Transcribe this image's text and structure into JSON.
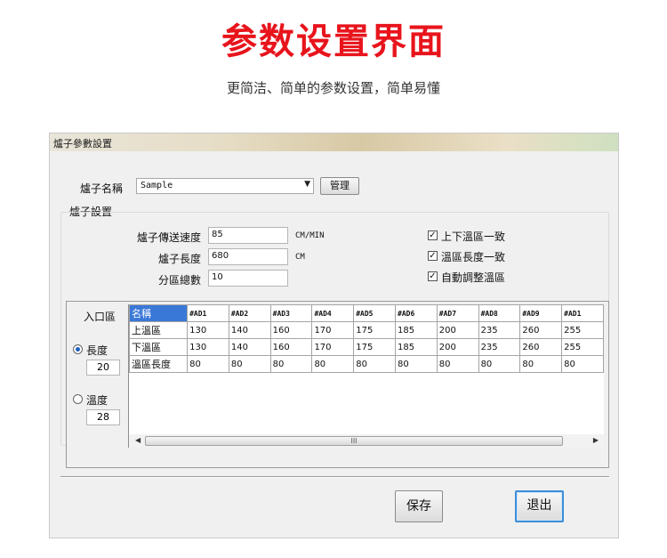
{
  "promo": {
    "title": "参数设置界面",
    "subtitle": "更简洁、简单的参数设置，简单易懂"
  },
  "window": {
    "title": "爐子參數設置"
  },
  "furnace_name": {
    "label": "爐子名稱",
    "value": "Sample",
    "manage_button": "管理"
  },
  "furnace_settings": {
    "group_label": "爐子設置",
    "speed": {
      "label": "爐子傳送速度",
      "value": "85",
      "unit": "CM/MIN"
    },
    "length": {
      "label": "爐子長度",
      "value": "680",
      "unit": "CM"
    },
    "zones": {
      "label": "分區總數",
      "value": "10"
    },
    "checkboxes": [
      {
        "label": "上下溫區一致",
        "checked": true
      },
      {
        "label": "溫區長度一致",
        "checked": true
      },
      {
        "label": "自動調整溫區",
        "checked": true
      }
    ]
  },
  "entrance": {
    "label": "入口區",
    "length_option": {
      "label": "長度",
      "selected": true,
      "value": "20"
    },
    "temp_option": {
      "label": "溫度",
      "selected": false,
      "value": "28"
    }
  },
  "zone_table": {
    "header": [
      "名稱",
      "#AD1",
      "#AD2",
      "#AD3",
      "#AD4",
      "#AD5",
      "#AD6",
      "#AD7",
      "#AD8",
      "#AD9",
      "#AD1"
    ],
    "rows": [
      [
        "上溫區",
        "130",
        "140",
        "160",
        "170",
        "175",
        "185",
        "200",
        "235",
        "260",
        "255"
      ],
      [
        "下溫區",
        "130",
        "140",
        "160",
        "170",
        "175",
        "185",
        "200",
        "235",
        "260",
        "255"
      ],
      [
        "溫區長度",
        "80",
        "80",
        "80",
        "80",
        "80",
        "80",
        "80",
        "80",
        "80",
        "80"
      ]
    ],
    "scrollbar_grip": "III"
  },
  "buttons": {
    "save": "保存",
    "exit": "退出"
  },
  "colors": {
    "promo_title": "#e8141c",
    "selected_cell": "#3a78d8",
    "focus_border": "#3c8ed8"
  }
}
